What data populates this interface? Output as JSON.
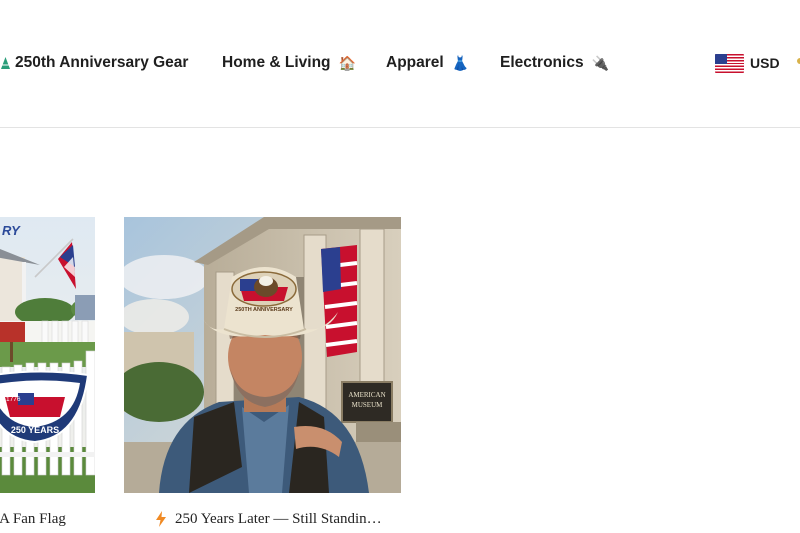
{
  "nav": {
    "items": [
      {
        "label": "250th Anniversary Gear",
        "icon": "party-hat-icon"
      },
      {
        "label": "Home & Living",
        "icon": "house-icon",
        "emoji": "🏠"
      },
      {
        "label": "Apparel",
        "icon": "dress-icon",
        "emoji": "👗"
      },
      {
        "label": "Electronics",
        "icon": "plug-icon",
        "emoji": "🔌"
      }
    ]
  },
  "currency": {
    "code": "USD",
    "flag_icon": "us-flag-icon"
  },
  "products": [
    {
      "title": "USA Fan Flag",
      "image": "fan-flag-on-fence-image"
    },
    {
      "title": "250 Years Later — Still Standin…",
      "badge_icon": "lightning-bolt-icon",
      "image": "cowboy-with-anniversary-hat-image"
    }
  ],
  "colors": {
    "accent": "#f08a24",
    "nav_text": "#1f1f1f",
    "divider": "#e3e3e3",
    "flag_blue": "#2b3f8f",
    "flag_red": "#c8102e"
  }
}
